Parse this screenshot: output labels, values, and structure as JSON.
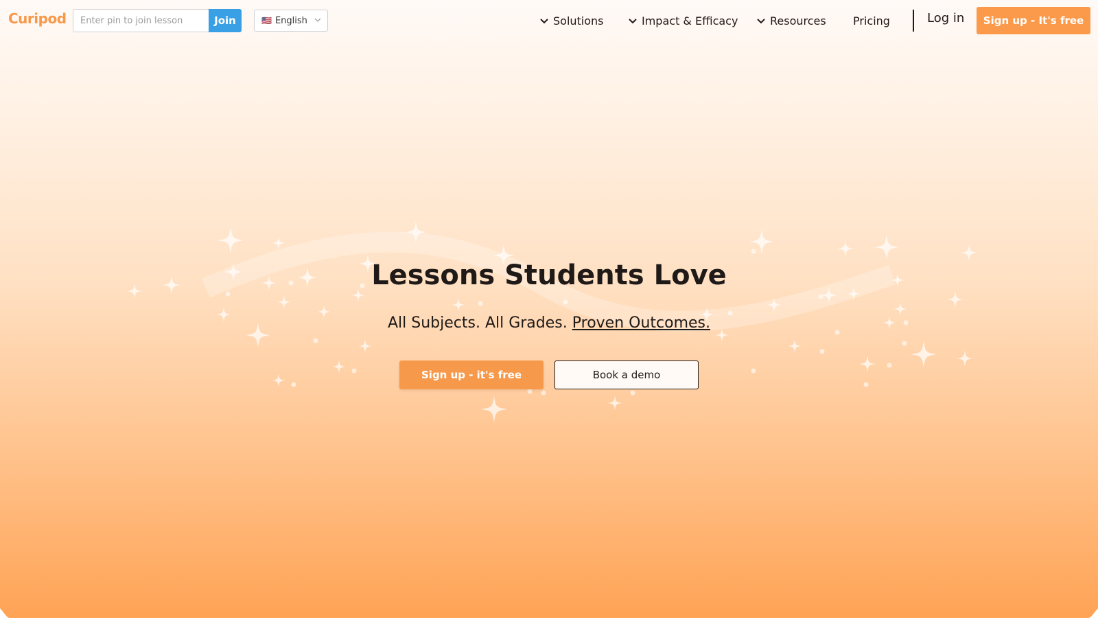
{
  "header": {
    "logo": "Curipod",
    "pin_placeholder": "Enter pin to join lesson",
    "join_label": "Join",
    "language": {
      "flag": "🇺🇸",
      "label": "English"
    },
    "nav": [
      {
        "label": "Solutions",
        "has_dropdown": true
      },
      {
        "label": "Impact & Efficacy",
        "has_dropdown": true
      },
      {
        "label": "Resources",
        "has_dropdown": true
      },
      {
        "label": "Pricing",
        "has_dropdown": false
      }
    ],
    "login_label": "Log in",
    "signup_label": "Sign up - It's free"
  },
  "hero": {
    "title": "Lessons Students Love",
    "subtitle_prefix": "All Subjects. All Grades.",
    "subtitle_link": "Proven Outcomes.",
    "cta_primary": "Sign up - it's free",
    "cta_secondary": "Book a demo"
  },
  "colors": {
    "brand_orange": "#f7994b",
    "join_blue": "#3aa0e6",
    "text_dark": "#1f1a17"
  },
  "icons": [
    "chevron-down-icon",
    "sparkle-icon"
  ]
}
